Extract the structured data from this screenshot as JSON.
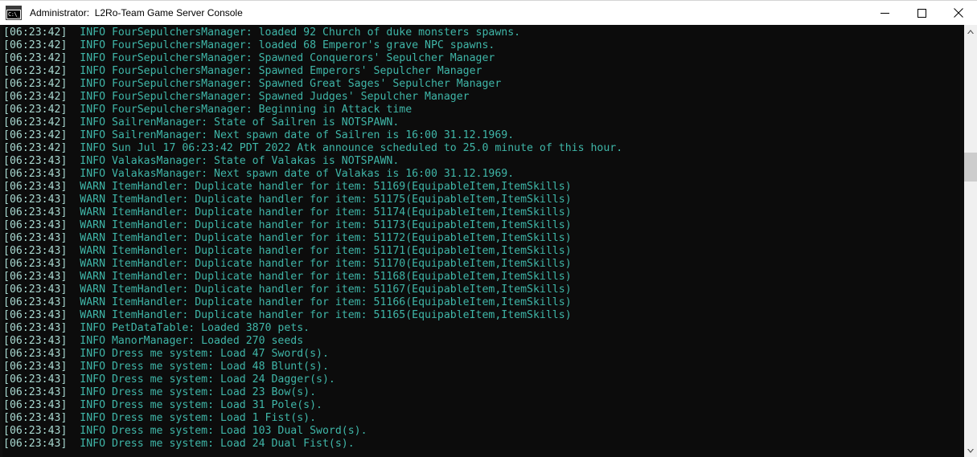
{
  "window": {
    "title": "Administrator:  L2Ro-Team Game Server Console",
    "icon_name": "console-app-icon",
    "icon_glyph": "C:\\_",
    "controls": {
      "minimize_label": "Minimize",
      "maximize_label": "Maximize",
      "close_label": "Close"
    }
  },
  "console": {
    "background_color": "#0c0c0c",
    "timestamp_color": "#a8d8d0",
    "text_color": "#3fb6a8",
    "lines": [
      {
        "timestamp": "[06:23:42]",
        "text": "  INFO FourSepulchersManager: loaded 92 Church of duke monsters spawns."
      },
      {
        "timestamp": "[06:23:42]",
        "text": "  INFO FourSepulchersManager: loaded 68 Emperor's grave NPC spawns."
      },
      {
        "timestamp": "[06:23:42]",
        "text": "  INFO FourSepulchersManager: Spawned Conquerors' Sepulcher Manager"
      },
      {
        "timestamp": "[06:23:42]",
        "text": "  INFO FourSepulchersManager: Spawned Emperors' Sepulcher Manager"
      },
      {
        "timestamp": "[06:23:42]",
        "text": "  INFO FourSepulchersManager: Spawned Great Sages' Sepulcher Manager"
      },
      {
        "timestamp": "[06:23:42]",
        "text": "  INFO FourSepulchersManager: Spawned Judges' Sepulcher Manager"
      },
      {
        "timestamp": "[06:23:42]",
        "text": "  INFO FourSepulchersManager: Beginning in Attack time"
      },
      {
        "timestamp": "[06:23:42]",
        "text": "  INFO SailrenManager: State of Sailren is NOTSPAWN."
      },
      {
        "timestamp": "[06:23:42]",
        "text": "  INFO SailrenManager: Next spawn date of Sailren is 16:00 31.12.1969."
      },
      {
        "timestamp": "[06:23:42]",
        "text": "  INFO Sun Jul 17 06:23:42 PDT 2022 Atk announce scheduled to 25.0 minute of this hour."
      },
      {
        "timestamp": "[06:23:43]",
        "text": "  INFO ValakasManager: State of Valakas is NOTSPAWN."
      },
      {
        "timestamp": "[06:23:43]",
        "text": "  INFO ValakasManager: Next spawn date of Valakas is 16:00 31.12.1969."
      },
      {
        "timestamp": "[06:23:43]",
        "text": "  WARN ItemHandler: Duplicate handler for item: 51169(EquipableItem,ItemSkills)"
      },
      {
        "timestamp": "[06:23:43]",
        "text": "  WARN ItemHandler: Duplicate handler for item: 51175(EquipableItem,ItemSkills)"
      },
      {
        "timestamp": "[06:23:43]",
        "text": "  WARN ItemHandler: Duplicate handler for item: 51174(EquipableItem,ItemSkills)"
      },
      {
        "timestamp": "[06:23:43]",
        "text": "  WARN ItemHandler: Duplicate handler for item: 51173(EquipableItem,ItemSkills)"
      },
      {
        "timestamp": "[06:23:43]",
        "text": "  WARN ItemHandler: Duplicate handler for item: 51172(EquipableItem,ItemSkills)"
      },
      {
        "timestamp": "[06:23:43]",
        "text": "  WARN ItemHandler: Duplicate handler for item: 51171(EquipableItem,ItemSkills)"
      },
      {
        "timestamp": "[06:23:43]",
        "text": "  WARN ItemHandler: Duplicate handler for item: 51170(EquipableItem,ItemSkills)"
      },
      {
        "timestamp": "[06:23:43]",
        "text": "  WARN ItemHandler: Duplicate handler for item: 51168(EquipableItem,ItemSkills)"
      },
      {
        "timestamp": "[06:23:43]",
        "text": "  WARN ItemHandler: Duplicate handler for item: 51167(EquipableItem,ItemSkills)"
      },
      {
        "timestamp": "[06:23:43]",
        "text": "  WARN ItemHandler: Duplicate handler for item: 51166(EquipableItem,ItemSkills)"
      },
      {
        "timestamp": "[06:23:43]",
        "text": "  WARN ItemHandler: Duplicate handler for item: 51165(EquipableItem,ItemSkills)"
      },
      {
        "timestamp": "[06:23:43]",
        "text": "  INFO PetDataTable: Loaded 3870 pets."
      },
      {
        "timestamp": "[06:23:43]",
        "text": "  INFO ManorManager: Loaded 270 seeds"
      },
      {
        "timestamp": "[06:23:43]",
        "text": "  INFO Dress me system: Load 47 Sword(s)."
      },
      {
        "timestamp": "[06:23:43]",
        "text": "  INFO Dress me system: Load 48 Blunt(s)."
      },
      {
        "timestamp": "[06:23:43]",
        "text": "  INFO Dress me system: Load 24 Dagger(s)."
      },
      {
        "timestamp": "[06:23:43]",
        "text": "  INFO Dress me system: Load 23 Bow(s)."
      },
      {
        "timestamp": "[06:23:43]",
        "text": "  INFO Dress me system: Load 31 Pole(s)."
      },
      {
        "timestamp": "[06:23:43]",
        "text": "  INFO Dress me system: Load 1 Fist(s)."
      },
      {
        "timestamp": "[06:23:43]",
        "text": "  INFO Dress me system: Load 103 Dual Sword(s)."
      },
      {
        "timestamp": "[06:23:43]",
        "text": "  INFO Dress me system: Load 24 Dual Fist(s)."
      }
    ]
  },
  "scrollbar": {
    "up_arrow_icon": "chevron-up-icon",
    "down_arrow_icon": "chevron-down-icon",
    "thumb_color": "#cdcdcd",
    "track_color": "#f0f0f0"
  }
}
